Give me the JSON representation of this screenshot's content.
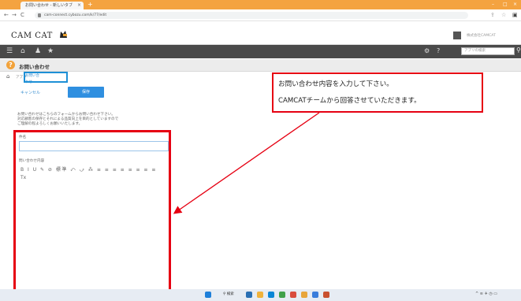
{
  "browser": {
    "tab_title": "お問い合わせ - 新しいタブ",
    "tab_close": "×",
    "new_tab": "+",
    "url": "cam-connect.cybozu.com/k/77/edit",
    "nav": [
      "←",
      "→",
      "C"
    ]
  },
  "header": {
    "logo": "CAM CAT",
    "user_name": "株式会社CAMCAT",
    "search_placeholder": "アプリの検索"
  },
  "page": {
    "title": "お問い合わせ",
    "breadcrumb_app": "アプリ",
    "breadcrumb_current": "お問い合わせ",
    "cancel_label": "キャンセル",
    "save_label": "保存",
    "intro_lines": [
      "お問い合わせはこちらのフォームからお問い合わせ下さい。",
      "対応顧客の保存とそれによる品質向上を目的としていますので",
      "ご理解の程よろしくお願いいたします。"
    ]
  },
  "form": {
    "subject_label": "件名",
    "subject_value": "",
    "body_label": "問い合わせ内容",
    "toolbar_text": "B I U ✎ ⊘ 標準 ⤺ ⤻ ⁂ ≡ ≡ ≡ ≡ ≡ ≡ ≡ ≡",
    "toolbar_row2": "Tx"
  },
  "callout": {
    "line1": "お問い合わせ内容を入力して下さい。",
    "line2": "CAMCATチームから回答させていただきます。"
  },
  "colors": {
    "accent_red": "#e60012",
    "save_blue": "#2f8fe0",
    "tab_orange": "#f4a340"
  }
}
